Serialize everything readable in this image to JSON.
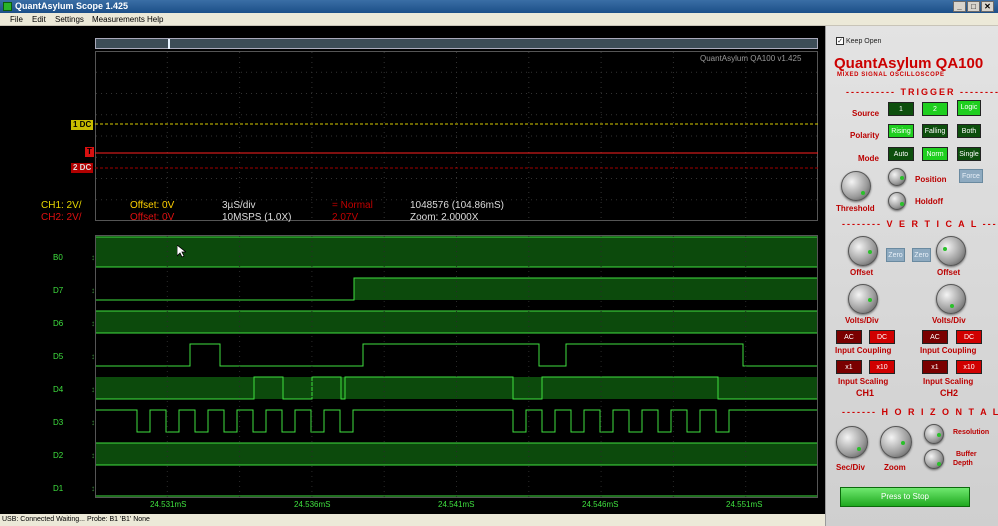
{
  "window": {
    "title": "QuantAsylum Scope 1.425",
    "controls": [
      "_",
      "□",
      "✕"
    ]
  },
  "menu": [
    "File",
    "Edit",
    "Settings",
    "Measurements",
    "Help"
  ],
  "scope": {
    "version_label": "QuantAsylum QA100 v1.425",
    "buffer_position": 0.1,
    "ch1_marker": "1 DC",
    "ch2_marker": "2 DC",
    "trigger_marker": "T",
    "readouts": {
      "ch1_scale": "CH1: 2V/",
      "ch2_scale": "CH2: 2V/",
      "ch1_offset": "Offset: 0V",
      "ch2_offset": "Offset: 0V",
      "timebase": "3µS/div",
      "samplerate": "10MSPS (1.0X)",
      "trigger_mode": "= Normal",
      "trigger_level": "2.07V",
      "samples": "1048576 (104.86mS)",
      "zoom": "Zoom: 2.0000X"
    },
    "digital_channels": [
      "B0",
      "D7",
      "D6",
      "D5",
      "D4",
      "D3",
      "D2",
      "D1"
    ],
    "time_labels": [
      "24.531mS",
      "24.536mS",
      "24.541mS",
      "24.546mS",
      "24.551mS"
    ],
    "colors": {
      "ch1": "#e8d800",
      "ch2": "#e01010",
      "digital": "#3fe03f",
      "ch1_offset": "#ffd000",
      "ch2_offset": "#e01010"
    }
  },
  "status": "USB: Connected  Waiting...  Probe: B1 'B1'  None",
  "panel": {
    "keep_open": "Keep Open",
    "brand": "QuantAsylum QA100",
    "brand_sub": "MIXED SIGNAL OSCILLOSCOPE",
    "trigger_title": "---------- TRIGGER ----------",
    "source_label": "Source",
    "source_1": "1",
    "source_2": "2",
    "source_logic": "Logic",
    "polarity_label": "Polarity",
    "polarity_rising": "Rising",
    "polarity_falling": "Falling",
    "polarity_both": "Both",
    "mode_label": "Mode",
    "mode_auto": "Auto",
    "mode_norm": "Norm",
    "mode_single": "Single",
    "force": "Force",
    "position": "Position",
    "holdoff": "Holdoff",
    "threshold": "Threshold",
    "vertical_title": "-------- V E R T I C A L --------",
    "zero_1": "Zero",
    "zero_2": "Zero",
    "offset_1": "Offset",
    "offset_2": "Offset",
    "voltsdiv_1": "Volts/Div",
    "voltsdiv_2": "Volts/Div",
    "ac_1": "AC",
    "dc_1": "DC",
    "ac_2": "AC",
    "dc_2": "DC",
    "coupling_1": "Input Coupling",
    "coupling_2": "Input Coupling",
    "x1_1": "x1",
    "x10_1": "x10",
    "x1_2": "x1",
    "x10_2": "x10",
    "scaling_1": "Input Scaling",
    "scaling_2": "Input Scaling",
    "ch1": "CH1",
    "ch2": "CH2",
    "horizontal_title": "------- H O R I Z O N T A L -------",
    "secdiv": "Sec/Div",
    "zoom": "Zoom",
    "resolution": "Resolution",
    "buffer_depth_1": "Buffer",
    "buffer_depth_2": "Depth",
    "run_button": "Press to Stop"
  }
}
